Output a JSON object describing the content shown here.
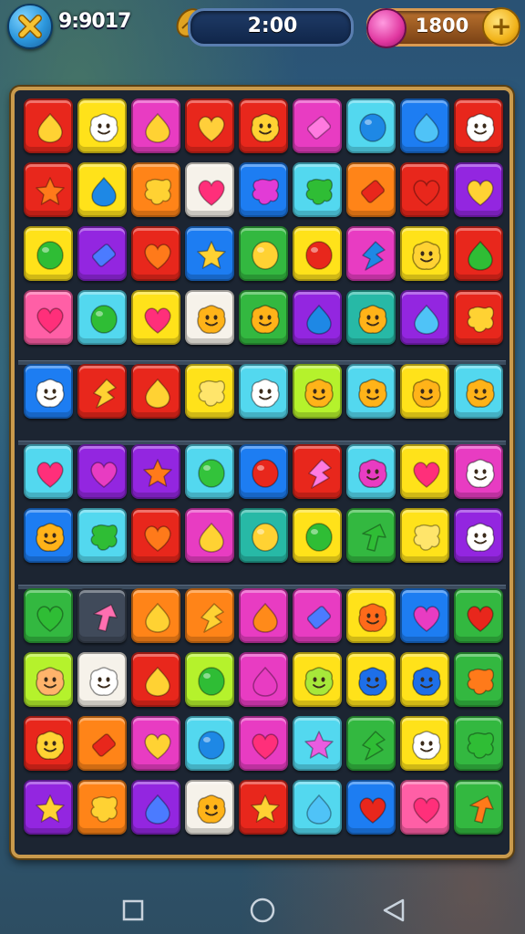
{
  "hud": {
    "score": "9:9017",
    "timer": "2:00",
    "coins": "1800",
    "close_icon": "close-x-icon",
    "timer_icon": "seed-icon",
    "gem_icon": "gem-icon",
    "plus_icon": "plus-icon"
  },
  "colors": {
    "red": "#e8271c",
    "yellow": "#ffe21a",
    "magenta": "#e83cc2",
    "cyan": "#53d8ef",
    "purple": "#9326e0",
    "orange": "#ff8418",
    "white": "#f6f2ea",
    "blue": "#1d7df2",
    "green": "#33b840",
    "pink": "#ff5fa6",
    "lime": "#b5f22c",
    "teal": "#27b9a6",
    "dark": "#404a5a"
  },
  "board": {
    "rows": [
      [
        [
          "red",
          "drop",
          "#ffd233"
        ],
        [
          "yellow",
          "face",
          "#ffffff"
        ],
        [
          "magenta",
          "drop",
          "#ffd233"
        ],
        [
          "red",
          "heart",
          "#ffcf3a"
        ],
        [
          "red",
          "face",
          "#ffd233"
        ],
        [
          "magenta",
          "rect",
          "#ff7ae0"
        ],
        [
          "cyan",
          "circle",
          "#1e88e5"
        ],
        [
          "blue",
          "drop",
          "#4fc3f7"
        ],
        [
          "red",
          "face",
          "#ffffff"
        ]
      ],
      [
        [
          "red",
          "star",
          "#ff7a1a"
        ],
        [
          "yellow",
          "drop",
          "#1e88e5"
        ],
        [
          "orange",
          "blob",
          "#ffd233"
        ],
        [
          "white",
          "heart",
          "#ff2f7a"
        ],
        [
          "blue",
          "blob",
          "#e23bd6"
        ],
        [
          "cyan",
          "blob",
          "#2fbd35"
        ],
        [
          "orange",
          "rect",
          "#e8271c"
        ],
        [
          "red",
          "heart",
          "#e8271c"
        ],
        [
          "purple",
          "heart",
          "#ffd233"
        ]
      ],
      [
        [
          "yellow",
          "circle",
          "#2fbd35"
        ],
        [
          "purple",
          "rect",
          "#4b7bff"
        ],
        [
          "red",
          "heart",
          "#ff7a1a"
        ],
        [
          "blue",
          "star",
          "#ffd233"
        ],
        [
          "green",
          "circle",
          "#ffd233"
        ],
        [
          "yellow",
          "circle",
          "#e8271c"
        ],
        [
          "magenta",
          "bolt",
          "#1e88e5"
        ],
        [
          "yellow",
          "face",
          "#ffd233"
        ],
        [
          "red",
          "drop",
          "#2fbd35"
        ]
      ],
      [
        [
          "pink",
          "heart",
          "#ff2f7a"
        ],
        [
          "cyan",
          "circle",
          "#2fbd35"
        ],
        [
          "yellow",
          "heart",
          "#ff2f7a"
        ],
        [
          "white",
          "face",
          "#ffb319"
        ],
        [
          "green",
          "face",
          "#ffb319"
        ],
        [
          "purple",
          "drop",
          "#1e88e5"
        ],
        [
          "teal",
          "face",
          "#ffb319"
        ],
        [
          "purple",
          "drop",
          "#4fc3f7"
        ],
        [
          "red",
          "blob",
          "#ffd233"
        ]
      ],
      [
        [
          "blue",
          "face",
          "#ffffff"
        ],
        [
          "red",
          "bolt",
          "#ffd233"
        ],
        [
          "red",
          "drop",
          "#ffd233"
        ],
        [
          "yellow",
          "blob",
          "#ffe56b"
        ],
        [
          "cyan",
          "face",
          "#ffffff"
        ],
        [
          "lime",
          "face",
          "#ffb319"
        ],
        [
          "cyan",
          "face",
          "#ffb319"
        ],
        [
          "yellow",
          "face",
          "#ffb319"
        ],
        [
          "cyan",
          "face",
          "#ffb319"
        ]
      ],
      [
        [
          "cyan",
          "heart",
          "#ff2f7a"
        ],
        [
          "purple",
          "heart",
          "#e83cc2"
        ],
        [
          "purple",
          "star",
          "#ff7a1a"
        ],
        [
          "cyan",
          "circle",
          "#33c33b"
        ],
        [
          "blue",
          "circle",
          "#e8271c"
        ],
        [
          "red",
          "bolt",
          "#ff7ae0"
        ],
        [
          "cyan",
          "face",
          "#e83cc2"
        ],
        [
          "yellow",
          "heart",
          "#ff2f7a"
        ],
        [
          "magenta",
          "face",
          "#ffffff"
        ]
      ],
      [
        [
          "blue",
          "face",
          "#ffb319"
        ],
        [
          "cyan",
          "blob",
          "#2fbd35"
        ],
        [
          "red",
          "heart",
          "#ff7a1a"
        ],
        [
          "magenta",
          "drop",
          "#ffd233"
        ],
        [
          "teal",
          "circle",
          "#ffd233"
        ],
        [
          "yellow",
          "circle",
          "#2fbd35"
        ],
        [
          "green",
          "arrow",
          "#2fbd35"
        ],
        [
          "yellow",
          "blob",
          "#ffe56b"
        ],
        [
          "purple",
          "face",
          "#ffffff"
        ]
      ],
      [
        [
          "green",
          "heart",
          "#2fbd35"
        ],
        [
          "dark",
          "arrow",
          "#ff6fb0"
        ],
        [
          "orange",
          "drop",
          "#ffd233"
        ],
        [
          "orange",
          "bolt",
          "#ffd233"
        ],
        [
          "magenta",
          "drop",
          "#ff8a1a"
        ],
        [
          "magenta",
          "rect",
          "#4b7bff"
        ],
        [
          "yellow",
          "face",
          "#ff6a1a"
        ],
        [
          "blue",
          "heart",
          "#e83cc2"
        ],
        [
          "green",
          "heart",
          "#e8271c"
        ]
      ],
      [
        [
          "lime",
          "face",
          "#ffb36b"
        ],
        [
          "white",
          "face",
          "#ffffff"
        ],
        [
          "red",
          "drop",
          "#ffd233"
        ],
        [
          "lime",
          "circle",
          "#2fbd35"
        ],
        [
          "magenta",
          "drop",
          "#e83cc2"
        ],
        [
          "yellow",
          "face",
          "#a7e83a"
        ],
        [
          "yellow",
          "face",
          "#1e6fe8"
        ],
        [
          "yellow",
          "face",
          "#1e6fe8"
        ],
        [
          "green",
          "blob",
          "#ff7a1a"
        ]
      ],
      [
        [
          "red",
          "face",
          "#ffd233"
        ],
        [
          "orange",
          "rect",
          "#e8271c"
        ],
        [
          "magenta",
          "heart",
          "#ffd233"
        ],
        [
          "cyan",
          "circle",
          "#1e88e5"
        ],
        [
          "magenta",
          "heart",
          "#ff2f7a"
        ],
        [
          "cyan",
          "star",
          "#e85de0"
        ],
        [
          "green",
          "bolt",
          "#2fbd35"
        ],
        [
          "yellow",
          "face",
          "#ffffff"
        ],
        [
          "green",
          "blob",
          "#2fbd35"
        ]
      ],
      [
        [
          "purple",
          "star",
          "#ffd233"
        ],
        [
          "orange",
          "blob",
          "#ffd233"
        ],
        [
          "purple",
          "drop",
          "#4b7bff"
        ],
        [
          "white",
          "face",
          "#ffb319"
        ],
        [
          "red",
          "star",
          "#ffd233"
        ],
        [
          "cyan",
          "drop",
          "#4fc3f7"
        ],
        [
          "blue",
          "heart",
          "#e8271c"
        ],
        [
          "pink",
          "heart",
          "#ff2f7a"
        ],
        [
          "green",
          "arrow",
          "#ff7a1a"
        ]
      ]
    ]
  },
  "nav": {
    "recents_icon": "square-icon",
    "home_icon": "circle-icon",
    "back_icon": "triangle-back-icon"
  }
}
